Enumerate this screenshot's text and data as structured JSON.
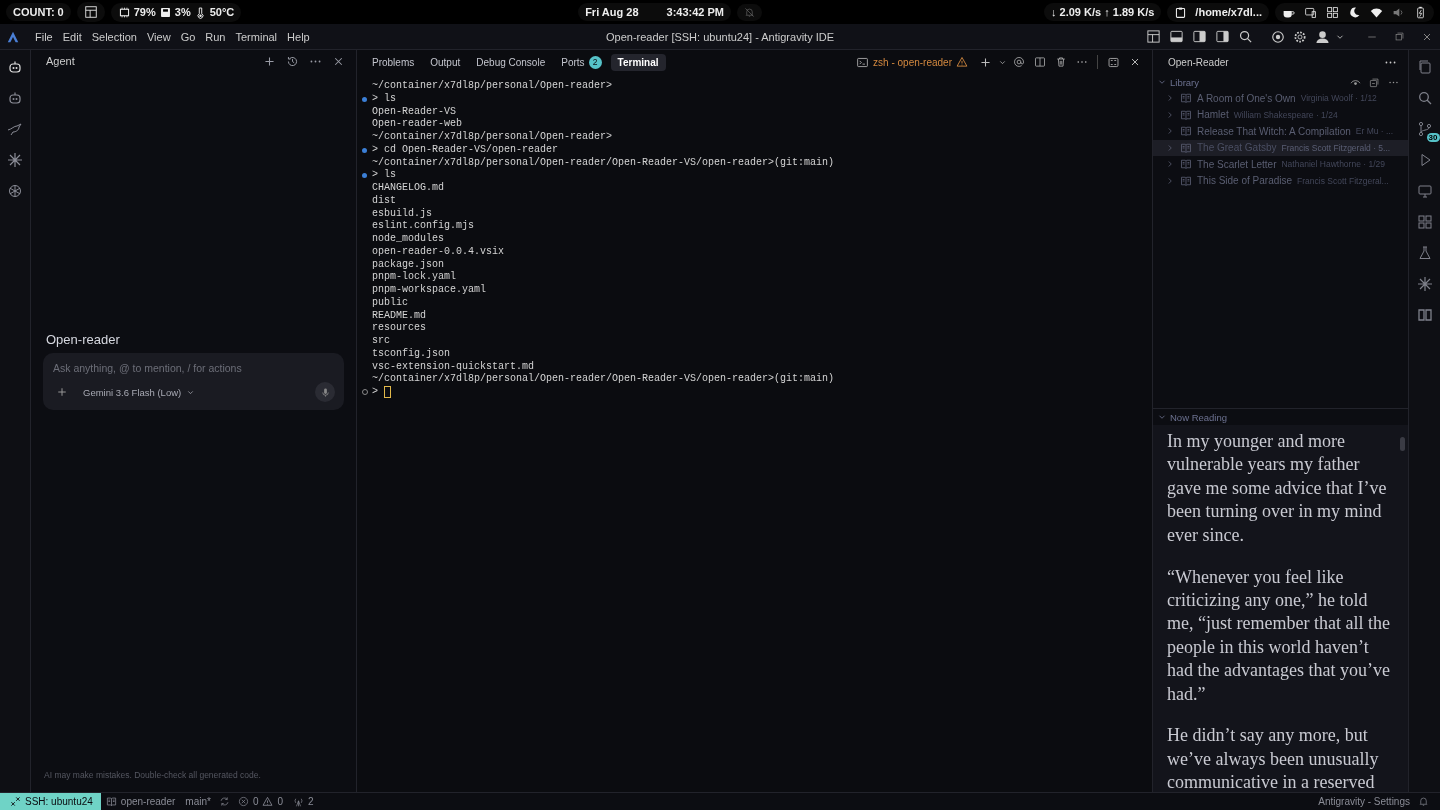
{
  "system_bar": {
    "count": "COUNT: 0",
    "cpu": "79%",
    "disk": "3%",
    "temperature": "50°C",
    "date": "Fri Aug 28",
    "time": "3:43:42 PM",
    "network": "↓ 2.09 K/s ↑ 1.89 K/s",
    "path": "/home/x7dl..."
  },
  "title_bar": {
    "menu": [
      "File",
      "Edit",
      "Selection",
      "View",
      "Go",
      "Run",
      "Terminal",
      "Help"
    ],
    "title": "Open-reader [SSH: ubuntu24] - Antigravity IDE"
  },
  "agent": {
    "title": "Agent",
    "workspace": "Open-reader",
    "placeholder": "Ask anything, @ to mention, / for actions",
    "model": "Gemini 3.6 Flash (Low)",
    "disclaimer": "AI may make mistakes. Double-check all generated code."
  },
  "panel_tabs": [
    {
      "label": "Problems",
      "selected": false
    },
    {
      "label": "Output",
      "selected": false
    },
    {
      "label": "Debug Console",
      "selected": false
    },
    {
      "label": "Ports",
      "badge": "2",
      "selected": false
    },
    {
      "label": "Terminal",
      "selected": true
    }
  ],
  "terminal": {
    "shell": "zsh - open-reader",
    "lines": [
      {
        "kind": "path",
        "text": "~/container/x7dl8p/personal/Open-reader>"
      },
      {
        "kind": "prompt",
        "text": "> ls",
        "done": true
      },
      {
        "kind": "output",
        "text": "Open-Reader-VS"
      },
      {
        "kind": "output",
        "text": "Open-reader-web"
      },
      {
        "kind": "path",
        "text": "~/container/x7dl8p/personal/Open-reader>"
      },
      {
        "kind": "prompt",
        "text": "> cd Open-Reader-VS/open-reader",
        "done": true
      },
      {
        "kind": "path",
        "text": "~/container/x7dl8p/personal/Open-reader/Open-Reader-VS/open-reader>(git:main)"
      },
      {
        "kind": "prompt",
        "text": "> ls",
        "done": true
      },
      {
        "kind": "output",
        "text": "CHANGELOG.md"
      },
      {
        "kind": "output",
        "text": "dist"
      },
      {
        "kind": "output",
        "text": "esbuild.js"
      },
      {
        "kind": "output",
        "text": "eslint.config.mjs"
      },
      {
        "kind": "output",
        "text": "node_modules"
      },
      {
        "kind": "output",
        "text": "open-reader-0.0.4.vsix"
      },
      {
        "kind": "output",
        "text": "package.json"
      },
      {
        "kind": "output",
        "text": "pnpm-lock.yaml"
      },
      {
        "kind": "output",
        "text": "pnpm-workspace.yaml"
      },
      {
        "kind": "output",
        "text": "public"
      },
      {
        "kind": "output",
        "text": "README.md"
      },
      {
        "kind": "output",
        "text": "resources"
      },
      {
        "kind": "output",
        "text": "src"
      },
      {
        "kind": "output",
        "text": "tsconfig.json"
      },
      {
        "kind": "output",
        "text": "vsc-extension-quickstart.md"
      },
      {
        "kind": "path",
        "text": "~/container/x7dl8p/personal/Open-reader/Open-Reader-VS/open-reader>(git:main)"
      },
      {
        "kind": "prompt",
        "text": ">",
        "done": false
      }
    ]
  },
  "reader_panel": {
    "title": "Open-Reader",
    "library": {
      "title": "Library",
      "expanded": true,
      "books": [
        {
          "title": "A Room of One's Own",
          "meta": "Virginia Woolf · 1/12",
          "selected": false
        },
        {
          "title": "Hamlet",
          "meta": "William Shakespeare · 1/24",
          "selected": false
        },
        {
          "title": "Release That Witch: A Compilation",
          "meta": "Er Mu · ...",
          "selected": false
        },
        {
          "title": "The Great Gatsby",
          "meta": "Francis Scott Fitzgerald · 5...",
          "selected": true
        },
        {
          "title": "The Scarlet Letter",
          "meta": "Nathaniel Hawthorne · 1/29",
          "selected": false
        },
        {
          "title": "This Side of Paradise",
          "meta": "Francis Scott Fitzgeral...",
          "selected": false
        }
      ]
    },
    "now_reading": {
      "title": "Now Reading",
      "expanded": true,
      "paragraphs": [
        "In my younger and more vulnerable years my father gave me some advice that I’ve been turning over in my mind ever since.",
        "“Whenever you feel like criticizing any one,” he told me, “just remember that all the people in this world haven’t had the advantages that you’ve had.”",
        "He didn’t say any more, but we’ve always been unusually communicative in a reserved"
      ]
    }
  },
  "right_activity": {
    "badge": "30"
  },
  "status_bar": {
    "remote": "SSH: ubuntu24",
    "repo": "open-reader",
    "branch": "main*",
    "errors": "0",
    "warnings": "0",
    "ports": "2",
    "right": "Antigravity - Settings"
  }
}
